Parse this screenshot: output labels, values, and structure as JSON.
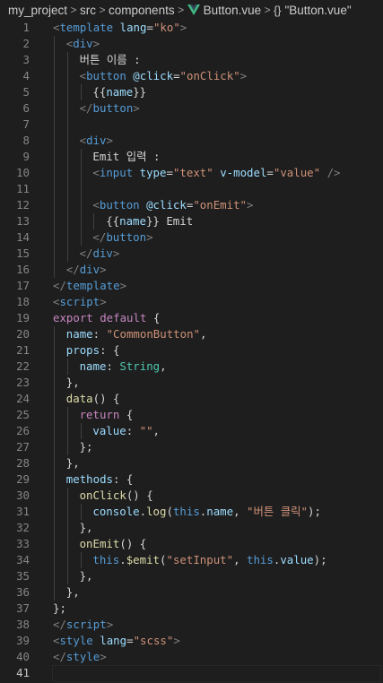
{
  "breadcrumb": {
    "items": [
      "my_project",
      "src",
      "components",
      "Button.vue",
      "\"Button.vue\""
    ],
    "separator": ">",
    "braces": "{}"
  },
  "editor": {
    "active_line": 41,
    "lines": [
      {
        "n": "1",
        "indent": 0,
        "tokens": [
          [
            "t-br",
            "<"
          ],
          [
            "t-tag",
            "template"
          ],
          [
            "t-txt",
            " "
          ],
          [
            "t-attr",
            "lang"
          ],
          [
            "t-txt",
            "="
          ],
          [
            "t-str",
            "\"ko\""
          ],
          [
            "t-br",
            ">"
          ]
        ]
      },
      {
        "n": "2",
        "indent": 1,
        "tokens": [
          [
            "t-br",
            "<"
          ],
          [
            "t-tag",
            "div"
          ],
          [
            "t-br",
            ">"
          ]
        ]
      },
      {
        "n": "3",
        "indent": 2,
        "tokens": [
          [
            "t-txt",
            "버튼 이름 :"
          ]
        ]
      },
      {
        "n": "4",
        "indent": 2,
        "tokens": [
          [
            "t-br",
            "<"
          ],
          [
            "t-tag",
            "button"
          ],
          [
            "t-txt",
            " "
          ],
          [
            "t-attr",
            "@click"
          ],
          [
            "t-txt",
            "="
          ],
          [
            "t-str",
            "\"onClick\""
          ],
          [
            "t-br",
            ">"
          ]
        ]
      },
      {
        "n": "5",
        "indent": 3,
        "tokens": [
          [
            "t-txt",
            "{{"
          ],
          [
            "t-key",
            "name"
          ],
          [
            "t-txt",
            "}}"
          ]
        ]
      },
      {
        "n": "6",
        "indent": 2,
        "tokens": [
          [
            "t-br",
            "</"
          ],
          [
            "t-tag",
            "button"
          ],
          [
            "t-br",
            ">"
          ]
        ]
      },
      {
        "n": "7",
        "indent": 2,
        "tokens": []
      },
      {
        "n": "8",
        "indent": 2,
        "tokens": [
          [
            "t-br",
            "<"
          ],
          [
            "t-tag",
            "div"
          ],
          [
            "t-br",
            ">"
          ]
        ]
      },
      {
        "n": "9",
        "indent": 3,
        "tokens": [
          [
            "t-txt",
            "Emit 입력 :"
          ]
        ]
      },
      {
        "n": "10",
        "indent": 3,
        "tokens": [
          [
            "t-br",
            "<"
          ],
          [
            "t-tag",
            "input"
          ],
          [
            "t-txt",
            " "
          ],
          [
            "t-attr",
            "type"
          ],
          [
            "t-txt",
            "="
          ],
          [
            "t-str",
            "\"text\""
          ],
          [
            "t-txt",
            " "
          ],
          [
            "t-attr",
            "v-model"
          ],
          [
            "t-txt",
            "="
          ],
          [
            "t-str",
            "\"value\""
          ],
          [
            "t-txt",
            " "
          ],
          [
            "t-br",
            "/>"
          ]
        ]
      },
      {
        "n": "11",
        "indent": 3,
        "tokens": []
      },
      {
        "n": "12",
        "indent": 3,
        "tokens": [
          [
            "t-br",
            "<"
          ],
          [
            "t-tag",
            "button"
          ],
          [
            "t-txt",
            " "
          ],
          [
            "t-attr",
            "@click"
          ],
          [
            "t-txt",
            "="
          ],
          [
            "t-str",
            "\"onEmit\""
          ],
          [
            "t-br",
            ">"
          ]
        ]
      },
      {
        "n": "13",
        "indent": 4,
        "tokens": [
          [
            "t-txt",
            "{{"
          ],
          [
            "t-key",
            "name"
          ],
          [
            "t-txt",
            "}} Emit"
          ]
        ]
      },
      {
        "n": "14",
        "indent": 3,
        "tokens": [
          [
            "t-br",
            "</"
          ],
          [
            "t-tag",
            "button"
          ],
          [
            "t-br",
            ">"
          ]
        ]
      },
      {
        "n": "15",
        "indent": 2,
        "tokens": [
          [
            "t-br",
            "</"
          ],
          [
            "t-tag",
            "div"
          ],
          [
            "t-br",
            ">"
          ]
        ]
      },
      {
        "n": "16",
        "indent": 1,
        "tokens": [
          [
            "t-br",
            "</"
          ],
          [
            "t-tag",
            "div"
          ],
          [
            "t-br",
            ">"
          ]
        ]
      },
      {
        "n": "17",
        "indent": 0,
        "tokens": [
          [
            "t-br",
            "</"
          ],
          [
            "t-tag",
            "template"
          ],
          [
            "t-br",
            ">"
          ]
        ]
      },
      {
        "n": "18",
        "indent": 0,
        "tokens": [
          [
            "t-br",
            "<"
          ],
          [
            "t-tag",
            "script"
          ],
          [
            "t-br",
            ">"
          ]
        ]
      },
      {
        "n": "19",
        "indent": 0,
        "tokens": [
          [
            "t-kw",
            "export default"
          ],
          [
            "t-txt",
            " {"
          ]
        ]
      },
      {
        "n": "20",
        "indent": 1,
        "tokens": [
          [
            "t-key",
            "name"
          ],
          [
            "t-txt",
            ": "
          ],
          [
            "t-str",
            "\"CommonButton\""
          ],
          [
            "t-txt",
            ","
          ]
        ]
      },
      {
        "n": "21",
        "indent": 1,
        "tokens": [
          [
            "t-key",
            "props"
          ],
          [
            "t-txt",
            ": {"
          ]
        ]
      },
      {
        "n": "22",
        "indent": 2,
        "tokens": [
          [
            "t-key",
            "name"
          ],
          [
            "t-txt",
            ": "
          ],
          [
            "t-type",
            "String"
          ],
          [
            "t-txt",
            ","
          ]
        ]
      },
      {
        "n": "23",
        "indent": 1,
        "tokens": [
          [
            "t-txt",
            "},"
          ]
        ]
      },
      {
        "n": "24",
        "indent": 1,
        "tokens": [
          [
            "t-fn",
            "data"
          ],
          [
            "t-txt",
            "() {"
          ]
        ]
      },
      {
        "n": "25",
        "indent": 2,
        "tokens": [
          [
            "t-kw",
            "return"
          ],
          [
            "t-txt",
            " {"
          ]
        ]
      },
      {
        "n": "26",
        "indent": 3,
        "tokens": [
          [
            "t-key",
            "value"
          ],
          [
            "t-txt",
            ": "
          ],
          [
            "t-str",
            "\"\""
          ],
          [
            "t-txt",
            ","
          ]
        ]
      },
      {
        "n": "27",
        "indent": 2,
        "tokens": [
          [
            "t-txt",
            "};"
          ]
        ]
      },
      {
        "n": "28",
        "indent": 1,
        "tokens": [
          [
            "t-txt",
            "},"
          ]
        ]
      },
      {
        "n": "29",
        "indent": 1,
        "tokens": [
          [
            "t-key",
            "methods"
          ],
          [
            "t-txt",
            ": {"
          ]
        ]
      },
      {
        "n": "30",
        "indent": 2,
        "tokens": [
          [
            "t-fn",
            "onClick"
          ],
          [
            "t-txt",
            "() {"
          ]
        ]
      },
      {
        "n": "31",
        "indent": 3,
        "tokens": [
          [
            "t-key",
            "console"
          ],
          [
            "t-txt",
            "."
          ],
          [
            "t-fn",
            "log"
          ],
          [
            "t-txt",
            "("
          ],
          [
            "t-this",
            "this"
          ],
          [
            "t-txt",
            "."
          ],
          [
            "t-key",
            "name"
          ],
          [
            "t-txt",
            ", "
          ],
          [
            "t-str",
            "\"버튼 클릭\""
          ],
          [
            "t-txt",
            ");"
          ]
        ]
      },
      {
        "n": "32",
        "indent": 2,
        "tokens": [
          [
            "t-txt",
            "},"
          ]
        ]
      },
      {
        "n": "33",
        "indent": 2,
        "tokens": [
          [
            "t-fn",
            "onEmit"
          ],
          [
            "t-txt",
            "() {"
          ]
        ]
      },
      {
        "n": "34",
        "indent": 3,
        "tokens": [
          [
            "t-this",
            "this"
          ],
          [
            "t-txt",
            "."
          ],
          [
            "t-fn",
            "$emit"
          ],
          [
            "t-txt",
            "("
          ],
          [
            "t-str",
            "\"setInput\""
          ],
          [
            "t-txt",
            ", "
          ],
          [
            "t-this",
            "this"
          ],
          [
            "t-txt",
            "."
          ],
          [
            "t-key",
            "value"
          ],
          [
            "t-txt",
            ");"
          ]
        ]
      },
      {
        "n": "35",
        "indent": 2,
        "tokens": [
          [
            "t-txt",
            "},"
          ]
        ]
      },
      {
        "n": "36",
        "indent": 1,
        "tokens": [
          [
            "t-txt",
            "},"
          ]
        ]
      },
      {
        "n": "37",
        "indent": 0,
        "tokens": [
          [
            "t-txt",
            "};"
          ]
        ]
      },
      {
        "n": "38",
        "indent": 0,
        "tokens": [
          [
            "t-br",
            "</"
          ],
          [
            "t-tag",
            "script"
          ],
          [
            "t-br",
            ">"
          ]
        ]
      },
      {
        "n": "39",
        "indent": 0,
        "tokens": [
          [
            "t-br",
            "<"
          ],
          [
            "t-tag",
            "style"
          ],
          [
            "t-txt",
            " "
          ],
          [
            "t-attr",
            "lang"
          ],
          [
            "t-txt",
            "="
          ],
          [
            "t-str",
            "\"scss\""
          ],
          [
            "t-br",
            ">"
          ]
        ]
      },
      {
        "n": "40",
        "indent": 0,
        "tokens": [
          [
            "t-br",
            "</"
          ],
          [
            "t-tag",
            "style"
          ],
          [
            "t-br",
            ">"
          ]
        ]
      },
      {
        "n": "41",
        "indent": 0,
        "tokens": []
      }
    ]
  },
  "colors": {
    "background": "#1e1e1e",
    "tag": "#569cd6",
    "attribute": "#9cdcfe",
    "string": "#ce9178",
    "keyword": "#c586c0",
    "function": "#dcdcaa",
    "type": "#4ec9b0"
  }
}
